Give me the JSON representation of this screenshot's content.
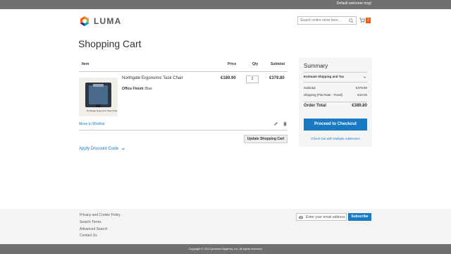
{
  "header": {
    "welcome": "Default welcome msg!",
    "logo_text": "LUMA",
    "search_placeholder": "Search entire store here...",
    "cart_count": "2"
  },
  "page": {
    "title": "Shopping Cart"
  },
  "cart": {
    "columns": {
      "item": "Item",
      "price": "Price",
      "qty": "Qty",
      "subtotal": "Subtotal"
    },
    "items": [
      {
        "name": "Northgate Ergonomic Task Chair",
        "image_caption": "Northgate Ergonomic Task Chair",
        "option_label": "Office Finish:",
        "option_value": "Blue",
        "price": "€189.90",
        "qty": "2",
        "subtotal": "€379.80"
      }
    ],
    "move_to_wishlist": "Move to Wishlist",
    "update_button": "Update Shopping Cart",
    "discount_label": "Apply Discount Code"
  },
  "summary": {
    "title": "Summary",
    "estimate_label": "Estimate Shipping and Tax",
    "subtotal_label": "Subtotal",
    "subtotal_value": "€379.80",
    "shipping_label": "Shipping (Flat Rate - Fixed)",
    "shipping_value": "€10.00",
    "order_total_label": "Order Total",
    "order_total_value": "€389.80",
    "checkout_button": "Proceed to Checkout",
    "multi_address": "Check Out with Multiple Addresses"
  },
  "footer": {
    "links": [
      "Privacy and Cookie Policy",
      "Search Terms",
      "Advanced Search",
      "Contact Us"
    ],
    "newsletter_placeholder": "Enter your email address",
    "subscribe_button": "Subscribe",
    "copyright": "Copyright © 2013-present Magento, Inc. All rights reserved."
  },
  "colors": {
    "accent": "#1979c3",
    "topbar": "#6e716e",
    "cart_badge": "#ff5501",
    "summary_bg": "#f5f5f5",
    "footer_bg": "#f4f4f4"
  },
  "icons": [
    "luma-logo-icon",
    "search-icon",
    "cart-icon",
    "edit-icon",
    "trash-icon",
    "chevron-down-icon",
    "mail-icon"
  ]
}
